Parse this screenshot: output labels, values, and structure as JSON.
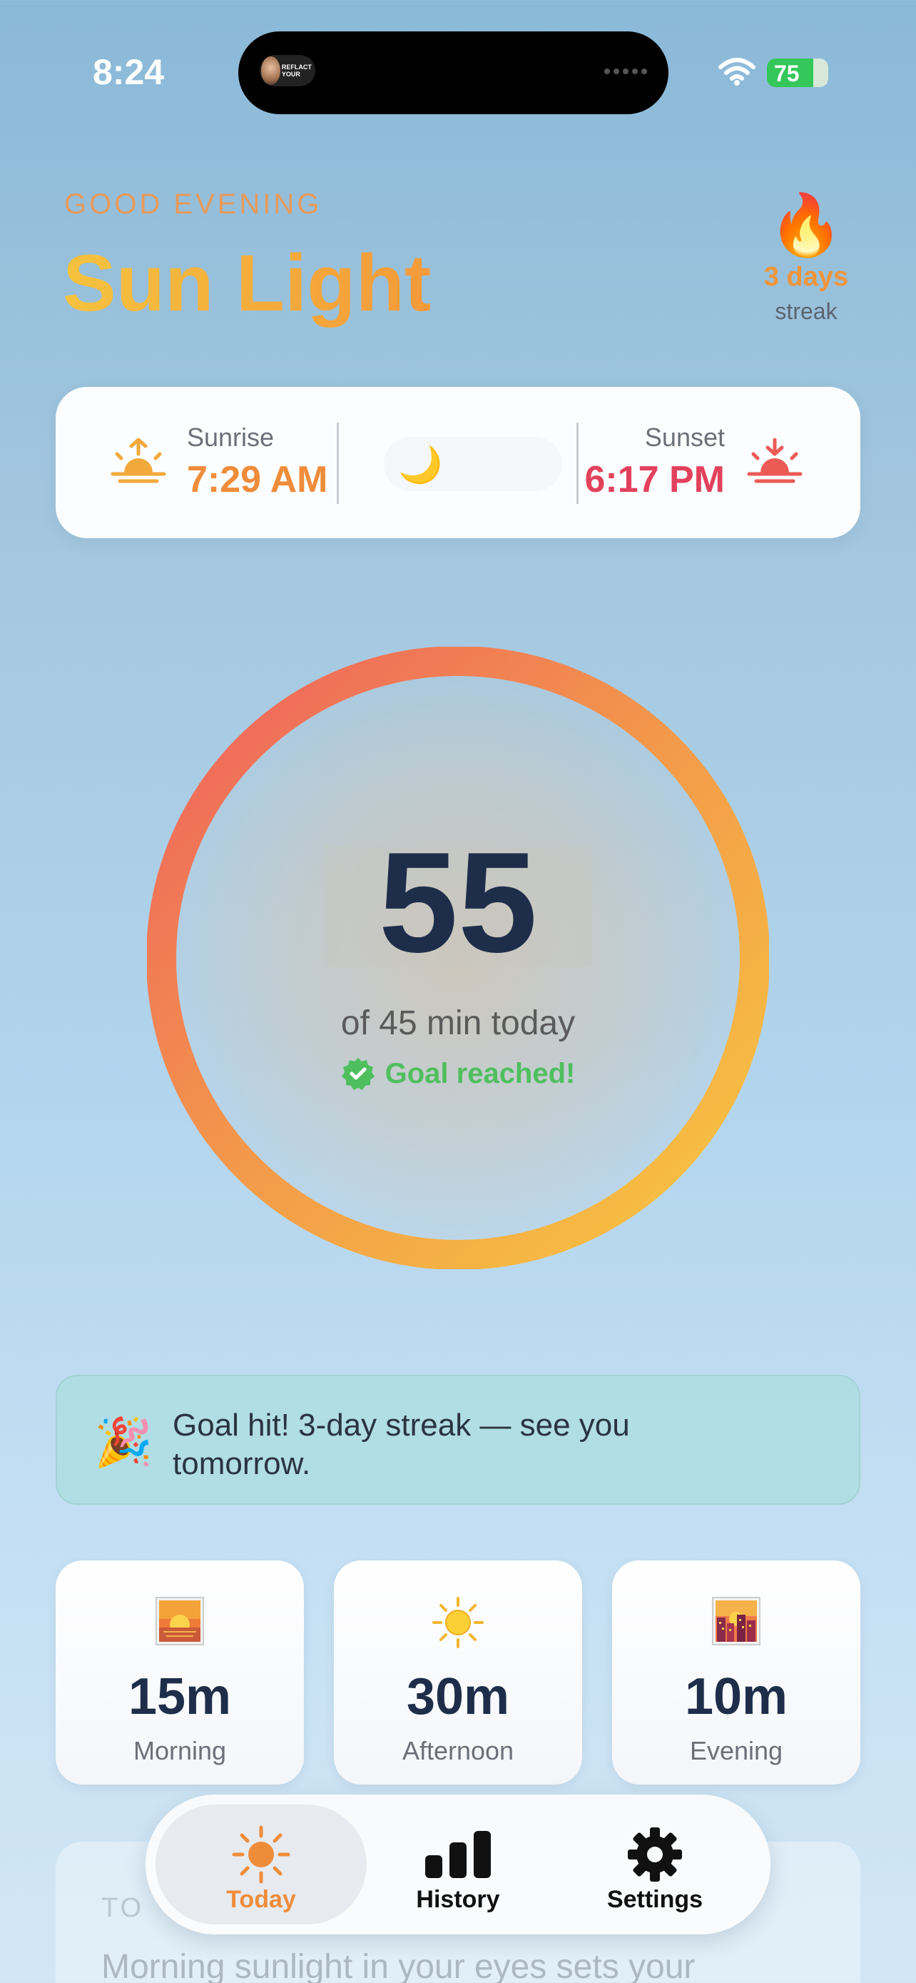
{
  "status_bar": {
    "time": "8:24",
    "battery": "75",
    "battery_level": 0.75,
    "island_thumb_text": "REFLACT YOUR"
  },
  "header": {
    "greeting": "GOOD EVENING",
    "title": "Sun Light"
  },
  "streak": {
    "icon": "fire-icon",
    "days": "3 days",
    "label": "streak"
  },
  "sun_times": {
    "sunrise_label": "Sunrise",
    "sunrise_time": "7:29 AM",
    "sunset_label": "Sunset",
    "sunset_time": "6:17 PM",
    "middle_icon": "moon-icon"
  },
  "progress": {
    "minutes": "55",
    "subtitle": "of 45 min today",
    "goal_status": "Goal reached!",
    "fraction": 1.0
  },
  "banner": {
    "icon": "party-popper-icon",
    "text": "Goal hit! 3-day streak — see you tomorrow."
  },
  "stats": [
    {
      "icon": "sunrise-photo-icon",
      "value": "15m",
      "label": "Morning"
    },
    {
      "icon": "sun-icon",
      "value": "30m",
      "label": "Afternoon"
    },
    {
      "icon": "sunset-city-icon",
      "value": "10m",
      "label": "Evening"
    }
  ],
  "tips": {
    "title": "TO",
    "text": "Morning sunlight in your eyes sets your"
  },
  "tabs": [
    {
      "label": "Today",
      "icon": "sun-icon",
      "active": true
    },
    {
      "label": "History",
      "icon": "bar-chart-icon",
      "active": false
    },
    {
      "label": "Settings",
      "icon": "gear-icon",
      "active": false
    }
  ],
  "colors": {
    "accent": "#ef8c3a",
    "sunset": "#e2415c",
    "success": "#4fbf5e",
    "ink": "#1e2e4a"
  }
}
